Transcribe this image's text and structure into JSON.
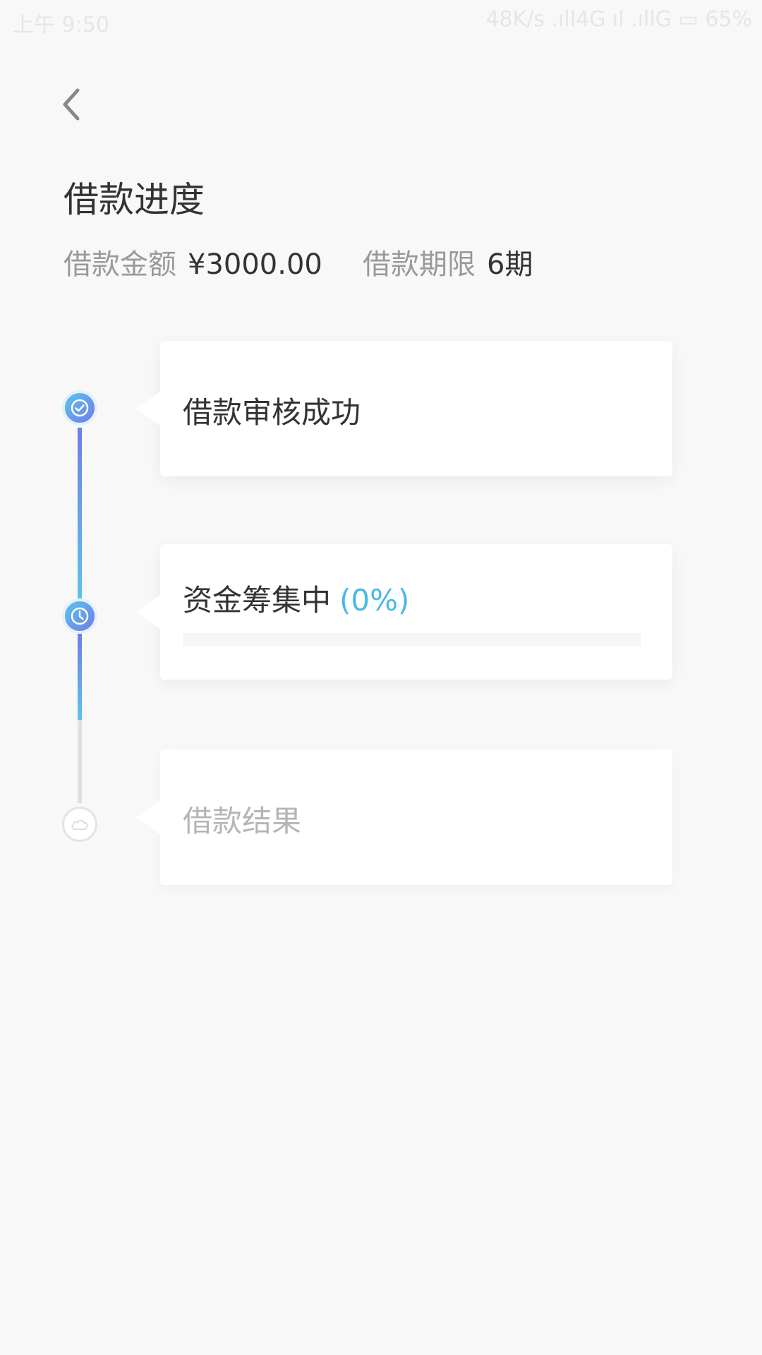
{
  "status_bar": {
    "time": "上午 9:50",
    "right": "48K/s .ıll4G ıl .ıllG ▭ 65%"
  },
  "header": {
    "back_icon": "chevron-left-icon",
    "title": "借款进度"
  },
  "summary": {
    "amount_label": "借款金额",
    "amount_value": "¥3000.00",
    "term_label": "借款期限",
    "term_value": "6期"
  },
  "steps": [
    {
      "title": "借款审核成功",
      "status": "done",
      "icon": "check-circle-icon"
    },
    {
      "title": "资金筹集中",
      "percent_text": "(0%)",
      "progress": 0,
      "status": "in-progress",
      "icon": "clock-icon"
    },
    {
      "title": "借款结果",
      "status": "pending",
      "icon": "cloud-icon"
    }
  ],
  "colors": {
    "accent_blue": "#4ab8e8",
    "gradient_start": "#5bc2ef",
    "gradient_end": "#6f7ee6",
    "pending_gray": "#b5b5b5",
    "background": "#f8f8f8"
  }
}
